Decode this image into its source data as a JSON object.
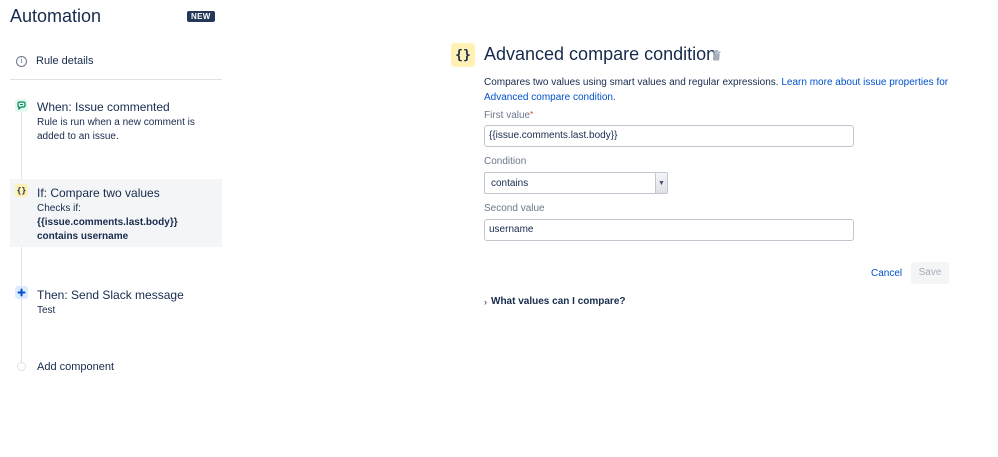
{
  "sidebar": {
    "title": "Automation",
    "badge": "NEW",
    "rule_details": "Rule details",
    "steps": [
      {
        "icon": "comment-icon",
        "title": "When: Issue commented",
        "desc_line1": "Rule is run when a new comment is",
        "desc_line2": "added to an issue."
      },
      {
        "icon": "braces-icon",
        "glyph": "{}",
        "title": "If: Compare two values",
        "desc_line1": "Checks if:",
        "desc_line2": "{{issue.comments.last.body}}",
        "desc_line3": "contains username"
      },
      {
        "icon": "slack-icon",
        "title": "Then: Send Slack message",
        "desc_line1": "Test"
      }
    ],
    "add_component": "Add component"
  },
  "panel": {
    "icon_glyph": "{}",
    "title": "Advanced compare condition",
    "description": "Compares two values using smart values and regular expressions. ",
    "link_line1": "Learn more about issue properties for",
    "link_line2": "Advanced compare condition.",
    "first_value_label": "First value",
    "required_mark": "*",
    "first_value": "{{issue.comments.last.body}}",
    "condition_label": "Condition",
    "condition_value": "contains",
    "second_value_label": "Second value",
    "second_value": "username",
    "cancel_label": "Cancel",
    "save_label": "Save",
    "disclosure_label": "What values can I compare?"
  },
  "colors": {
    "text": "#172b4d",
    "link": "#0052cc",
    "condition_icon_bg": "#fff0b3",
    "trigger_icon": "#00875a",
    "action_icon": "#0052cc",
    "active_step_bg": "#f4f5f7"
  }
}
